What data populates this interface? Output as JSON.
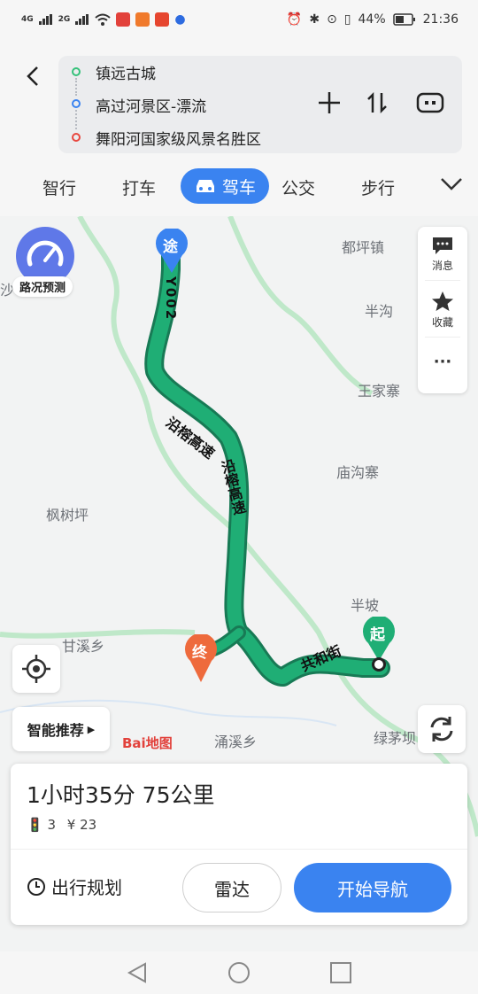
{
  "status_bar": {
    "signal_left": "4G",
    "signal_right": "2G",
    "battery": "44%",
    "time": "21:36"
  },
  "route": {
    "origin": "镇远古城",
    "waypoint": "高过河景区-漂流",
    "destination": "舞阳河国家级风景名胜区"
  },
  "tabs": [
    "智行",
    "打车",
    "驾车",
    "公交",
    "步行"
  ],
  "active_tab": "驾车",
  "map": {
    "traffic_predict_label": "路况预测",
    "side_panel": {
      "messages": "消息",
      "favorites": "收藏",
      "more": "···"
    },
    "smart_recommend": "智能推荐",
    "logo_text": "Bai地图",
    "place_names": {
      "p1": "都坪镇",
      "p2": "半沟",
      "p3": "王家寨",
      "p4": "庙沟寨",
      "p5": "枫树坪",
      "p6": "半坡",
      "p7": "甘溪乡",
      "p8": "涌溪乡",
      "p9": "绿茅坝",
      "p10": "沙"
    },
    "road_labels": {
      "r1": "Y002",
      "r2": "沿榕高速",
      "r3": "沿榕高速",
      "r4": "共和街"
    },
    "markers": {
      "waypoint": "途",
      "start": "起",
      "end": "终"
    }
  },
  "summary": {
    "duration_distance": "1小时35分  75公里",
    "traffic_lights": "3",
    "toll": "¥ 23"
  },
  "actions": {
    "plan": "出行规划",
    "radar": "雷达",
    "start_nav": "开始导航"
  },
  "colors": {
    "accent": "#3a83f0",
    "route": "#1fae75",
    "origin_dot": "#35c17a",
    "waypoint_dot": "#3a83f0",
    "dest_dot": "#e8473f",
    "end_marker": "#ee6a3c"
  }
}
